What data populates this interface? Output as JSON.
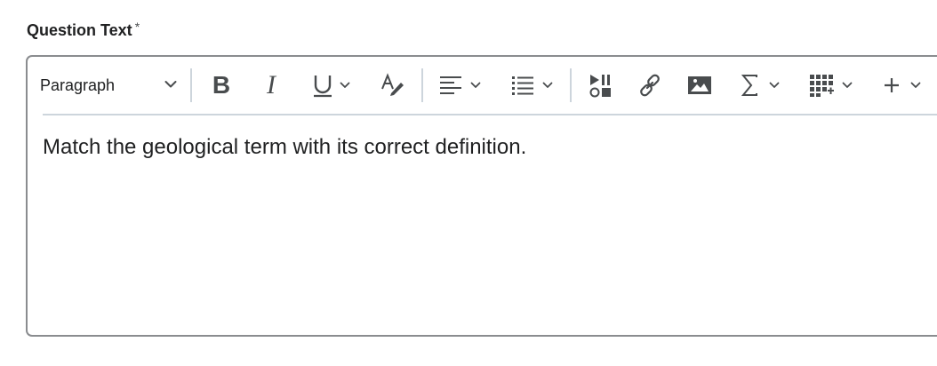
{
  "field": {
    "label": "Question Text",
    "required_marker": "*"
  },
  "toolbar": {
    "block_format": "Paragraph",
    "buttons": [
      {
        "name": "bold",
        "icon": "bold-icon"
      },
      {
        "name": "italic",
        "icon": "italic-icon"
      },
      {
        "name": "underline",
        "icon": "underline-icon",
        "has_dropdown": true
      },
      {
        "name": "text-color",
        "icon": "text-color-icon"
      },
      {
        "name": "align",
        "icon": "align-left-icon",
        "has_dropdown": true
      },
      {
        "name": "list",
        "icon": "bullet-list-icon",
        "has_dropdown": true
      },
      {
        "name": "insert-media",
        "icon": "media-icon"
      },
      {
        "name": "insert-link",
        "icon": "link-icon"
      },
      {
        "name": "insert-image",
        "icon": "image-icon"
      },
      {
        "name": "equation",
        "icon": "sigma-icon",
        "has_dropdown": true
      },
      {
        "name": "table",
        "icon": "table-icon",
        "has_dropdown": true
      },
      {
        "name": "insert-more",
        "icon": "plus-icon",
        "has_dropdown": true
      }
    ]
  },
  "editor": {
    "content": "Match the geological term with its correct definition."
  }
}
